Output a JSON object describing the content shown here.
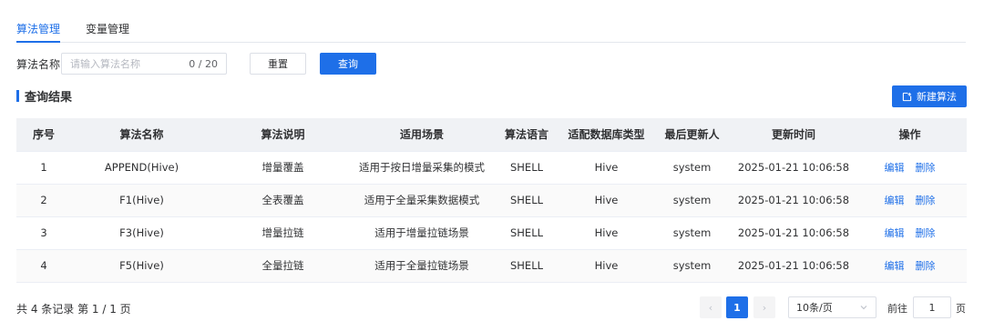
{
  "tabs": [
    {
      "label": "算法管理",
      "active": true
    },
    {
      "label": "变量管理",
      "active": false
    }
  ],
  "search": {
    "label": "算法名称",
    "placeholder": "请输入算法名称",
    "value": "",
    "count": "0 / 20",
    "reset_label": "重置",
    "query_label": "查询"
  },
  "results": {
    "title": "查询结果",
    "new_button_label": "新建算法"
  },
  "table": {
    "headers": [
      "序号",
      "算法名称",
      "算法说明",
      "适用场景",
      "算法语言",
      "适配数据库类型",
      "最后更新人",
      "更新时间",
      "操作"
    ],
    "rows": [
      {
        "index": "1",
        "name": "APPEND(Hive)",
        "desc": "增量覆盖",
        "scene": "适用于按日增量采集的模式",
        "lang": "SHELL",
        "db": "Hive",
        "updater": "system",
        "time": "2025-01-21 10:06:58"
      },
      {
        "index": "2",
        "name": "F1(Hive)",
        "desc": "全表覆盖",
        "scene": "适用于全量采集数据模式",
        "lang": "SHELL",
        "db": "Hive",
        "updater": "system",
        "time": "2025-01-21 10:06:58"
      },
      {
        "index": "3",
        "name": "F3(Hive)",
        "desc": "增量拉链",
        "scene": "适用于增量拉链场景",
        "lang": "SHELL",
        "db": "Hive",
        "updater": "system",
        "time": "2025-01-21 10:06:58"
      },
      {
        "index": "4",
        "name": "F5(Hive)",
        "desc": "全量拉链",
        "scene": "适用于全量拉链场景",
        "lang": "SHELL",
        "db": "Hive",
        "updater": "system",
        "time": "2025-01-21 10:06:58"
      }
    ],
    "edit_label": "编辑",
    "delete_label": "删除"
  },
  "pagination": {
    "total_text": "共 4 条记录 第 1 / 1 页",
    "prev": "‹",
    "current": "1",
    "next": "›",
    "page_size": "10条/页",
    "goto_label": "前往",
    "goto_value": "1",
    "goto_unit": "页"
  },
  "colors": {
    "primary": "#1e6fe8",
    "header_bg": "#f0f2f5"
  },
  "icons": {
    "new_button": "add-square-icon",
    "page_size_dropdown": "chevron-down-icon"
  }
}
